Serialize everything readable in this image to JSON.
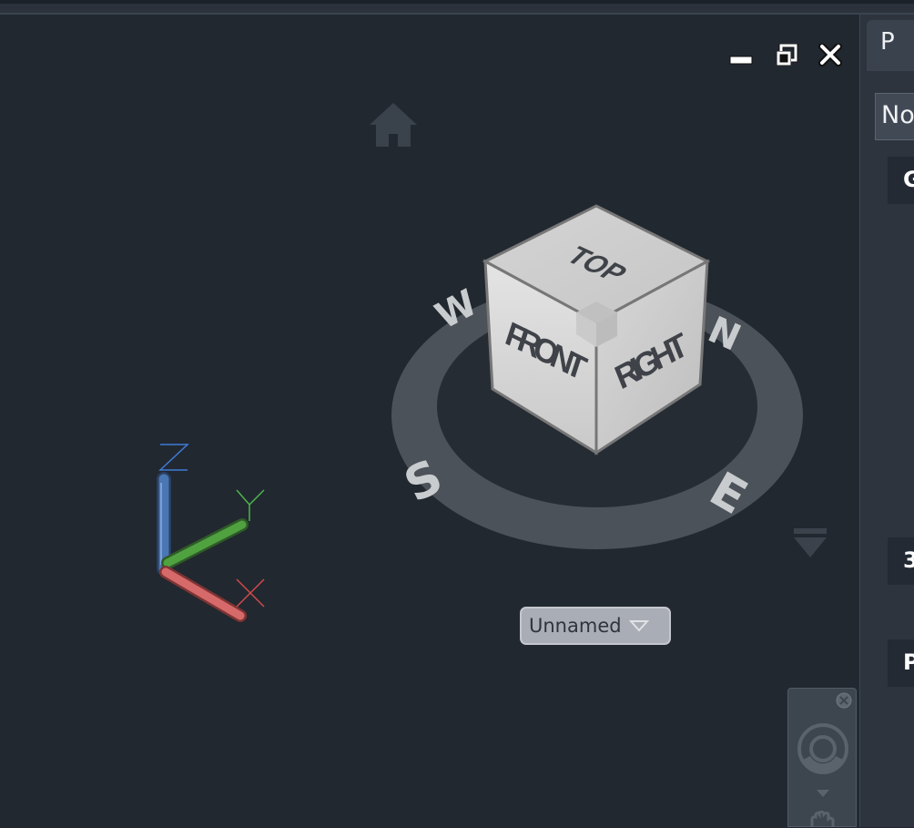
{
  "window_controls": {
    "minimize_icon": "minimize-icon",
    "restore_icon": "restore-icon",
    "close_icon": "close-icon"
  },
  "viewcube": {
    "face_top": "TOP",
    "face_front": "FRONT",
    "face_right": "RIGHT",
    "compass": {
      "north": "N",
      "south": "S",
      "east": "E",
      "west": "W"
    },
    "home_icon": "home-icon",
    "menu_icon": "triangle-down-icon"
  },
  "named_view": {
    "label": "Unnamed"
  },
  "ucs": {
    "x_label": "X",
    "y_label": "Y",
    "z_label": "Z"
  },
  "nav_bar": {
    "close_icon": "close-icon",
    "wheel_icon": "steering-wheel-icon",
    "pan_icon": "pan-icon"
  },
  "right_panel": {
    "tab_label": "P",
    "select_value": "No",
    "sections": [
      "G",
      "3",
      "P"
    ]
  },
  "colors": {
    "viewport_bg": "#212830",
    "x_axis": "#d15a5a",
    "y_axis": "#4f9a3f",
    "z_axis": "#3f6fae"
  }
}
